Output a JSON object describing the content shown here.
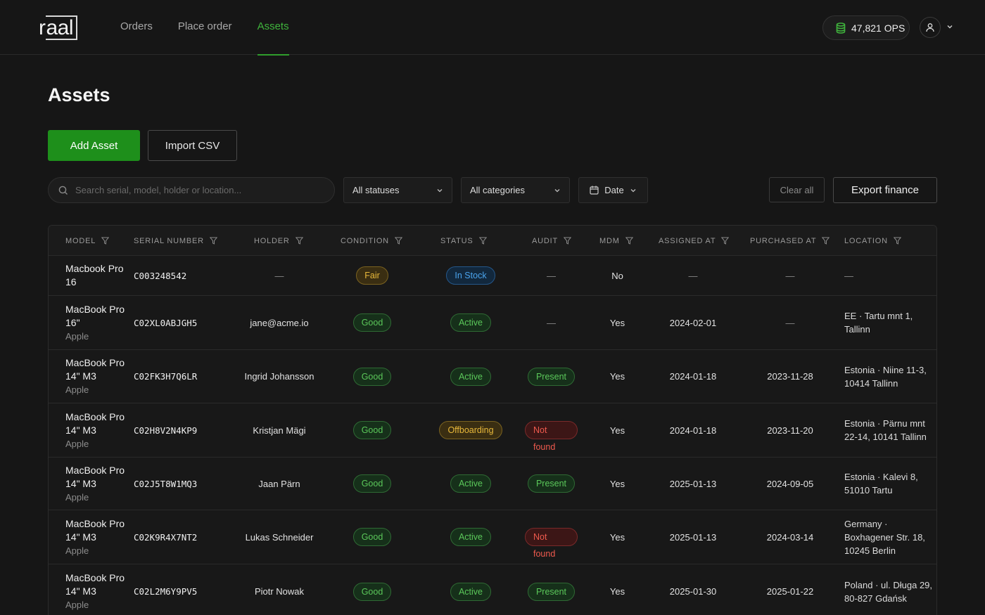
{
  "header": {
    "logo": "raal",
    "nav": [
      "Orders",
      "Place order",
      "Assets"
    ],
    "active_nav": "Assets",
    "ops_balance": "47,821 OPS"
  },
  "page": {
    "title": "Assets",
    "add_asset_label": "Add Asset",
    "import_csv_label": "Import CSV"
  },
  "filters": {
    "search_placeholder": "Search serial, model, holder or location...",
    "status": "All statuses",
    "category": "All categories",
    "date": "Date",
    "clear_all": "Clear all",
    "export_finance": "Export finance"
  },
  "table": {
    "columns": [
      "MODEL",
      "SERIAL NUMBER",
      "HOLDER",
      "CONDITION",
      "STATUS",
      "AUDIT",
      "MDM",
      "ASSIGNED AT",
      "PURCHASED AT",
      "LOCATION"
    ],
    "rows": [
      {
        "model": "Macbook Pro 16",
        "brand": "",
        "serial": "C003248542",
        "holder": "—",
        "condition": "Fair",
        "status": "In Stock",
        "audit": "",
        "mdm": "No",
        "assigned": "—",
        "purchased": "—",
        "location": "—"
      },
      {
        "model": "MacBook Pro 16\"",
        "brand": "Apple",
        "serial": "C02XL0ABJGH5",
        "holder": "jane@acme.io",
        "condition": "Good",
        "status": "Active",
        "audit": "",
        "mdm": "Yes",
        "assigned": "2024-02-01",
        "purchased": "—",
        "location": "EE · Tartu mnt 1, Tallinn"
      },
      {
        "model": "MacBook Pro 14\" M3",
        "brand": "Apple",
        "serial": "C02FK3H7Q6LR",
        "holder": "Ingrid Johansson",
        "condition": "Good",
        "status": "Active",
        "audit": "Present",
        "mdm": "Yes",
        "assigned": "2024-01-18",
        "purchased": "2023-11-28",
        "location": "Estonia · Niine 11-3, 10414 Tallinn"
      },
      {
        "model": "MacBook Pro 14\" M3",
        "brand": "Apple",
        "serial": "C02H8V2N4KP9",
        "holder": "Kristjan Mägi",
        "condition": "Good",
        "status": "Offboarding",
        "audit": "Not found",
        "mdm": "Yes",
        "assigned": "2024-01-18",
        "purchased": "2023-11-20",
        "location": "Estonia · Pärnu mnt 22-14, 10141 Tallinn"
      },
      {
        "model": "MacBook Pro 14\" M3",
        "brand": "Apple",
        "serial": "C02J5T8W1MQ3",
        "holder": "Jaan Pärn",
        "condition": "Good",
        "status": "Active",
        "audit": "Present",
        "mdm": "Yes",
        "assigned": "2025-01-13",
        "purchased": "2024-09-05",
        "location": "Estonia · Kalevi 8, 51010 Tartu"
      },
      {
        "model": "MacBook Pro 14\" M3",
        "brand": "Apple",
        "serial": "C02K9R4X7NT2",
        "holder": "Lukas Schneider",
        "condition": "Good",
        "status": "Active",
        "audit": "Not found",
        "mdm": "Yes",
        "assigned": "2025-01-13",
        "purchased": "2024-03-14",
        "location": "Germany · Boxhagener Str. 18, 10245 Berlin"
      },
      {
        "model": "MacBook Pro 14\" M3",
        "brand": "Apple",
        "serial": "C02L2M6Y9PV5",
        "holder": "Piotr Nowak",
        "condition": "Good",
        "status": "Active",
        "audit": "Present",
        "mdm": "Yes",
        "assigned": "2025-01-30",
        "purchased": "2025-01-22",
        "location": "Poland · ul. Długa 29, 80-827 Gdańsk"
      }
    ]
  },
  "empty_value": "—",
  "colors": {
    "accent_green": "#1e8f1b",
    "nav_active": "#3fb33c",
    "badge_warning": "#e8b83a",
    "badge_info": "#4aa3ec",
    "badge_danger": "#ef5a4e"
  }
}
